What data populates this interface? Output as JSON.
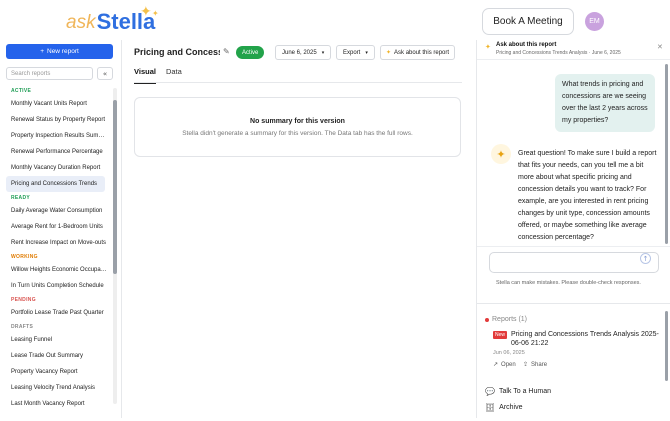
{
  "brand": {
    "ask": "ask",
    "name": "Stella"
  },
  "header": {
    "book_meeting": "Book A Meeting",
    "avatar_initials": "EM"
  },
  "sidebar": {
    "new_report": "New report",
    "search_placeholder": "Search reports",
    "collapse": "«",
    "sections": [
      {
        "label": "ACTIVE",
        "color": "#1f9d55",
        "items": [
          "Monthly Vacant Units Report",
          "Renewal Status by Property Report",
          "Property Inspection Results Summary",
          "Renewal Performance Percentage",
          "Monthly Vacancy Duration Report",
          "Pricing and Concessions Trends"
        ]
      },
      {
        "label": "READY",
        "color": "#1f9d55",
        "items": [
          "Daily Average Water Consumption",
          "Average Rent for 1-Bedroom Units",
          "Rent Increase Impact on Move-outs"
        ]
      },
      {
        "label": "WORKING",
        "color": "#e07b00",
        "items": [
          "Willow Heights Economic Occupancy",
          "In Turn Units Completion Schedule"
        ]
      },
      {
        "label": "PENDING",
        "color": "#d9534f",
        "items": [
          "Portfolio Lease Trade Past Quarter"
        ]
      },
      {
        "label": "DRAFTS",
        "color": "#888888",
        "items": [
          "Leasing Funnel",
          "Lease Trade Out Summary",
          "Property Vacancy Report",
          "Leasing Velocity Trend Analysis",
          "Last Month Vacancy Report"
        ]
      }
    ]
  },
  "main": {
    "title": "Pricing and Concessions Trends",
    "status": "Active",
    "date": "June 6, 2025",
    "export": "Export",
    "ask": "Ask about this report",
    "tabs": [
      "Visual",
      "Data"
    ],
    "empty_title": "No summary for this version",
    "empty_sub": "Stella didn't generate a summary for this version. The Data tab has the full rows."
  },
  "chat": {
    "head_title": "Ask about this report",
    "head_sub": "Pricing and Concessions Trends Analysis · June 6, 2025",
    "user_msg": "What trends in pricing and concessions are we seeing over the last 2 years across my properties?",
    "bot_msg": "Great question! To make sure I build a report that fits your needs, can you tell me a bit more about what specific pricing and concession details you want to track? For example, are you interested in rent pricing changes by unit type, concession amounts offered, or maybe something like average concession percentage?",
    "disclaimer": "Stella can make mistakes. Please double-check responses.",
    "reports_label": "Reports (1)",
    "new_badge": "New",
    "report_name": "Pricing and Concessions Trends Analysis 2025-06-06 21:22",
    "report_date": "Jun 06, 2025",
    "open": "Open",
    "share": "Share",
    "talk_human": "Talk To a Human",
    "archive": "Archive"
  }
}
